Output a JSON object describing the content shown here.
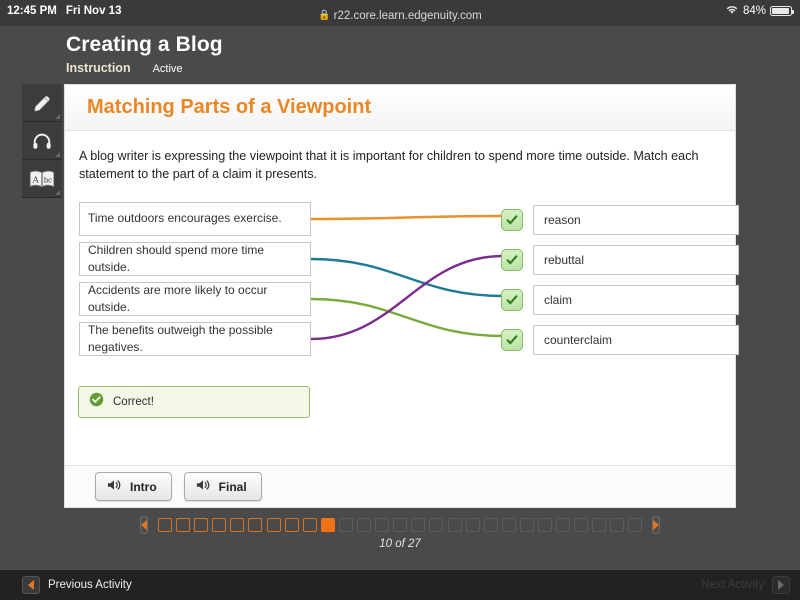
{
  "statusbar": {
    "time": "12:45 PM",
    "date": "Fri Nov 13",
    "battery_percent": "84%",
    "wifi_icon": "wifi-icon",
    "battery_icon": "battery-icon"
  },
  "browser": {
    "url": "r22.core.learn.edgenuity.com",
    "lock_icon": "lock-icon"
  },
  "lesson": {
    "title": "Creating a Blog",
    "kind": "Instruction",
    "state": "Active"
  },
  "toolrail": {
    "items": [
      {
        "name": "pencil-tool",
        "icon": "pencil-icon"
      },
      {
        "name": "audio-tool",
        "icon": "headphones-icon"
      },
      {
        "name": "glossary-tool",
        "icon": "dictionary-book-icon"
      }
    ]
  },
  "card": {
    "heading": "Matching Parts of a Viewpoint",
    "prompt": "A blog writer is expressing the viewpoint that it is important for children to spend more time outside. Match each statement to the part of a claim it presents."
  },
  "matching": {
    "left_items": [
      {
        "text": "Time outdoors encourages exercise.",
        "color": "#e8912d"
      },
      {
        "text": "Children should spend more time outside.",
        "color": "#1f7a94"
      },
      {
        "text": "Accidents are more likely to occur outside.",
        "color": "#7aa93c"
      },
      {
        "text": "The benefits outweigh the possible negatives.",
        "color": "#7b2d8e"
      }
    ],
    "right_items": [
      {
        "text": "reason",
        "status_icon": "check-icon"
      },
      {
        "text": "rebuttal",
        "status_icon": "check-icon"
      },
      {
        "text": "claim",
        "status_icon": "check-icon"
      },
      {
        "text": "counterclaim",
        "status_icon": "check-icon"
      }
    ],
    "connections": [
      {
        "from": 0,
        "to": 0,
        "color": "#e8912d"
      },
      {
        "from": 1,
        "to": 2,
        "color": "#1f7a94"
      },
      {
        "from": 2,
        "to": 3,
        "color": "#7aa93c"
      },
      {
        "from": 3,
        "to": 1,
        "color": "#7b2d8e"
      }
    ]
  },
  "feedback": {
    "text": "Correct!",
    "icon": "check-circle-icon"
  },
  "audio": {
    "buttons": [
      {
        "label": "Intro",
        "icon": "speaker-icon"
      },
      {
        "label": "Final",
        "icon": "speaker-icon"
      }
    ]
  },
  "pagination": {
    "prev_icon": "caret-left-icon",
    "next_icon": "caret-right-icon",
    "total": 27,
    "current": 10,
    "label": "10 of 27"
  },
  "activitybar": {
    "previous_label": "Previous Activity",
    "next_label": "Next Activity",
    "prev_icon": "caret-left-icon",
    "next_icon": "caret-right-icon"
  },
  "colors": {
    "accent_orange": "#ef7215",
    "heading_orange": "#e98724",
    "chrome_dark": "#4a4a4a",
    "statusbar": "#3a3a3a",
    "check_green": "#2f7d22"
  }
}
